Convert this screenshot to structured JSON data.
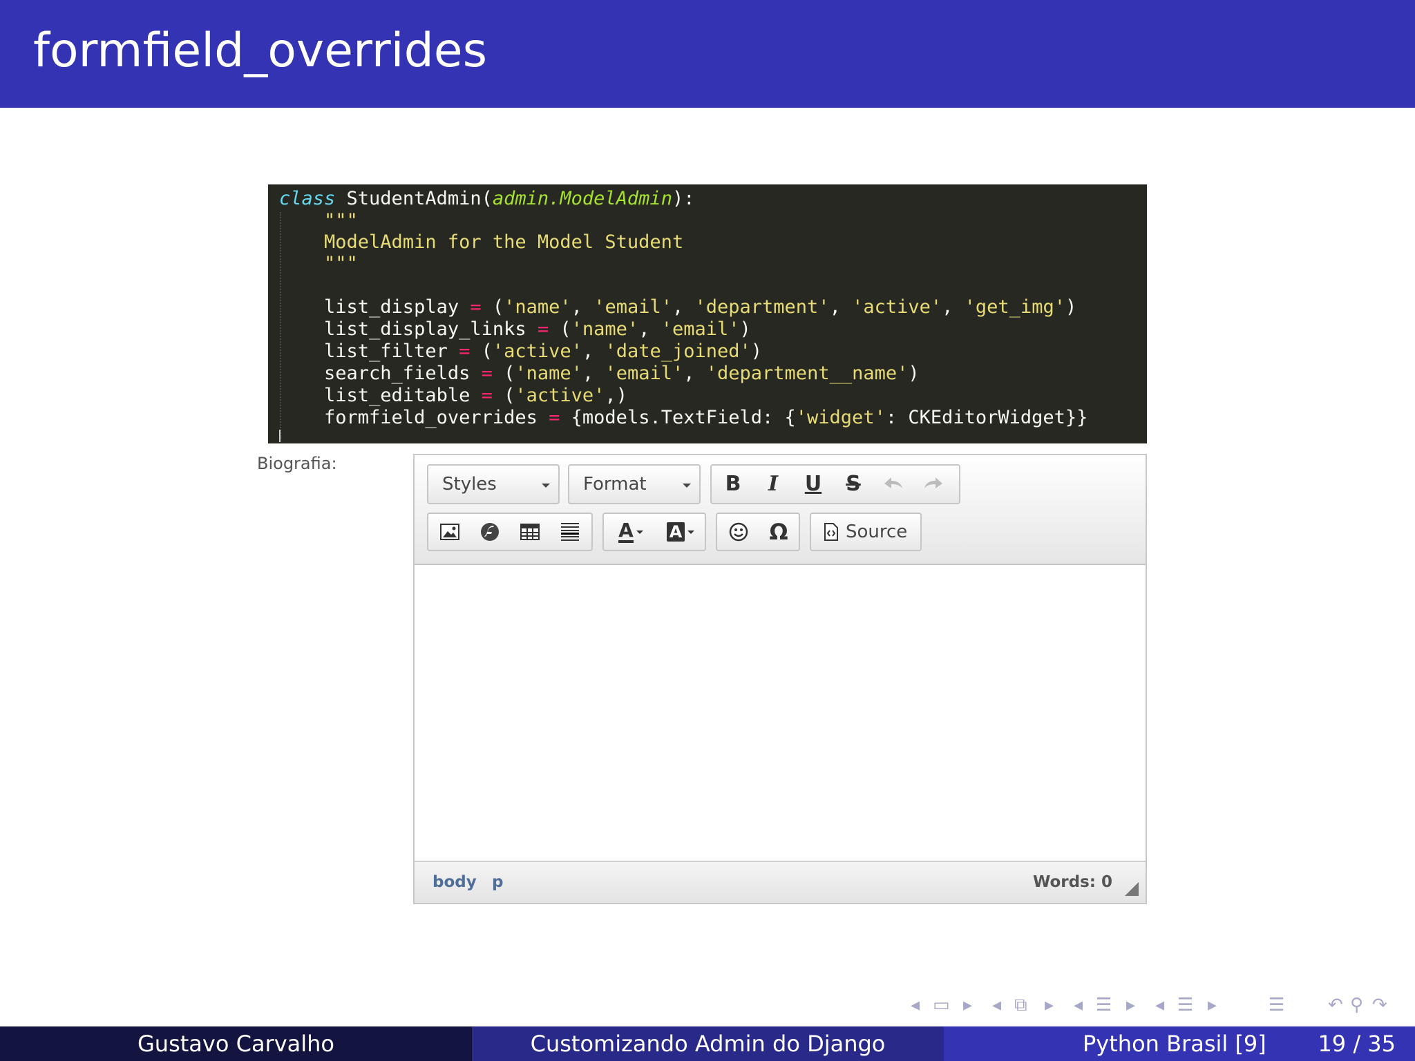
{
  "slide": {
    "title": "formfield_overrides"
  },
  "code": {
    "line1": {
      "kw": "class",
      "name": " StudentAdmin(",
      "parent": "admin.ModelAdmin",
      "end": "):"
    },
    "doc_open": "    \"\"\"",
    "doc_text": "    ModelAdmin for the Model Student",
    "doc_close": "    \"\"\"",
    "list_display": {
      "attr": "    list_display ",
      "op": "=",
      "pre": " (",
      "items": [
        "'name'",
        "'email'",
        "'department'",
        "'active'",
        "'get_img'"
      ],
      "post": ")"
    },
    "list_display_links": {
      "attr": "    list_display_links ",
      "op": "=",
      "pre": " (",
      "items": [
        "'name'",
        "'email'"
      ],
      "post": ")"
    },
    "list_filter": {
      "attr": "    list_filter ",
      "op": "=",
      "pre": " (",
      "items": [
        "'active'",
        "'date_joined'"
      ],
      "post": ")"
    },
    "search_fields": {
      "attr": "    search_fields ",
      "op": "=",
      "pre": " (",
      "items": [
        "'name'",
        "'email'",
        "'department__name'"
      ],
      "post": ")"
    },
    "list_editable": {
      "attr": "    list_editable ",
      "op": "=",
      "pre": " (",
      "items": [
        "'active'"
      ],
      "post": ",)"
    },
    "formfield_overrides": {
      "attr": "    formfield_overrides ",
      "op": "=",
      "pre": " {models.TextField: {",
      "key": "'widget'",
      "post": ": CKEditorWidget}}"
    }
  },
  "form": {
    "field_label": "Biografia:"
  },
  "editor": {
    "styles_label": "Styles",
    "format_label": "Format",
    "bold_label": "B",
    "italic_label": "I",
    "underline_label": "U",
    "strike_label": "S",
    "text_color_label": "A",
    "bg_color_label": "A",
    "special_char_label": "Ω",
    "source_label": "Source",
    "path": [
      "body",
      "p"
    ],
    "word_count": "Words: 0",
    "icons": [
      "bold-icon",
      "italic-icon",
      "underline-icon",
      "strikethrough-icon",
      "undo-icon",
      "redo-icon",
      "image-icon",
      "flash-icon",
      "table-icon",
      "horizontal-rule-icon",
      "text-color-icon",
      "background-color-icon",
      "smiley-icon",
      "special-char-icon",
      "source-icon"
    ]
  },
  "nav": {
    "icons": [
      "nav-frame-prev-icon",
      "nav-frame-icon",
      "nav-frame-next-icon",
      "nav-slide-prev-icon",
      "nav-slide-icon",
      "nav-slide-next-icon",
      "nav-subsection-prev-icon",
      "nav-subsection-icon",
      "nav-subsection-next-icon",
      "nav-section-prev-icon",
      "nav-section-icon",
      "nav-section-next-icon",
      "nav-toc-icon",
      "nav-back-icon",
      "nav-search-icon",
      "nav-forward-icon"
    ]
  },
  "footer": {
    "author": "Gustavo Carvalho",
    "talk_title": "Customizando Admin do Django",
    "event": "Python Brasil [9]",
    "page": "19 / 35"
  },
  "colors": {
    "title_bar": "#3333b3",
    "code_bg": "#272822",
    "code_keyword": "#66d9ef",
    "code_parent": "#a6e22e",
    "code_string": "#e6db74",
    "code_operator": "#f92672",
    "footer_dark": "#141440",
    "footer_mid": "#29298a"
  }
}
